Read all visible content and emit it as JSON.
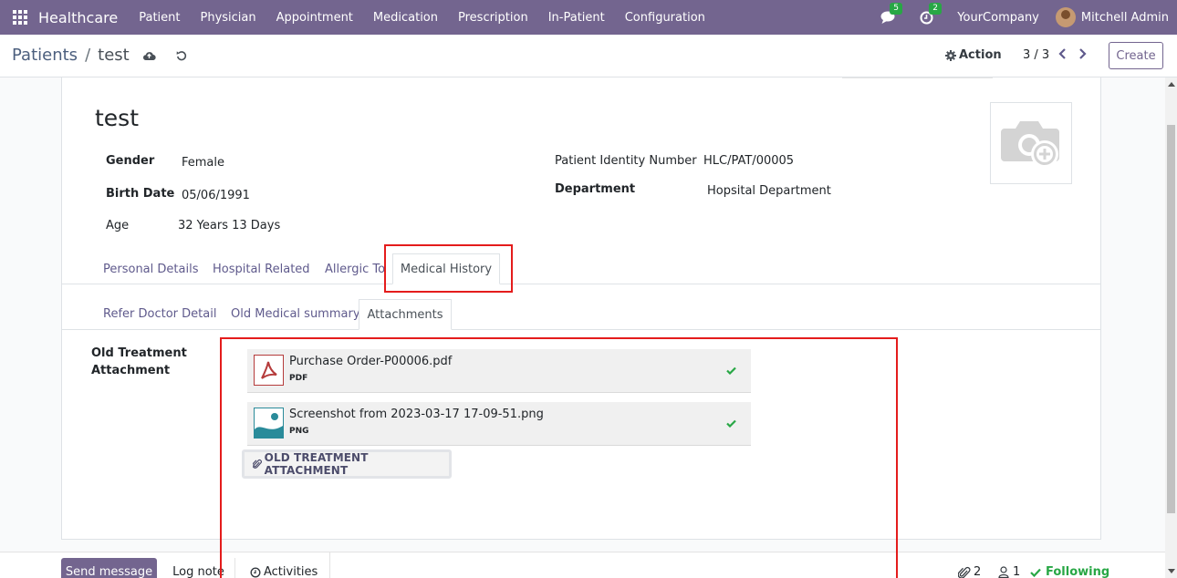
{
  "navbar": {
    "brand": "Healthcare",
    "menu": [
      "Patient",
      "Physician",
      "Appointment",
      "Medication",
      "Prescription",
      "In-Patient",
      "Configuration"
    ],
    "messages_count": "5",
    "activities_count": "2",
    "company": "YourCompany",
    "user": "Mitchell Admin"
  },
  "control": {
    "breadcrumb_parent": "Patients",
    "breadcrumb_sep": "/",
    "breadcrumb_current": "test",
    "action_label": "Action",
    "pager": "3 / 3",
    "create_label": "Create"
  },
  "record": {
    "name": "test",
    "gender_label": "Gender",
    "gender": "Female",
    "birth_label": "Birth Date",
    "birth_date": "05/06/1991",
    "age_label": "Age",
    "age": "32 Years 13 Days",
    "pid_label": "Patient Identity Number",
    "pid": "HLC/PAT/00005",
    "dept_label": "Department",
    "department": "Hopsital Department"
  },
  "tabs": [
    "Personal Details",
    "Hospital Related",
    "Allergic To",
    "Medical History"
  ],
  "subtabs": [
    "Refer Doctor Detail",
    "Old Medical summary",
    "Attachments"
  ],
  "attachments": {
    "field_label_line1": "Old Treatment",
    "field_label_line2": "Attachment",
    "files": [
      {
        "name": "Purchase Order-P00006.pdf",
        "type": "PDF",
        "icon": "pdf-icon"
      },
      {
        "name": "Screenshot from 2023-03-17 17-09-51.png",
        "type": "PNG",
        "icon": "image-icon"
      }
    ],
    "upload_label": "OLD TREATMENT ATTACHMENT"
  },
  "chatter": {
    "send_message": "Send message",
    "log_note": "Log note",
    "activities": "Activities",
    "attachments_count": "2",
    "followers_count": "1",
    "following": "Following"
  },
  "colors": {
    "navbar": "#73658f",
    "highlight": "#e41c1c",
    "success": "#28a745"
  }
}
